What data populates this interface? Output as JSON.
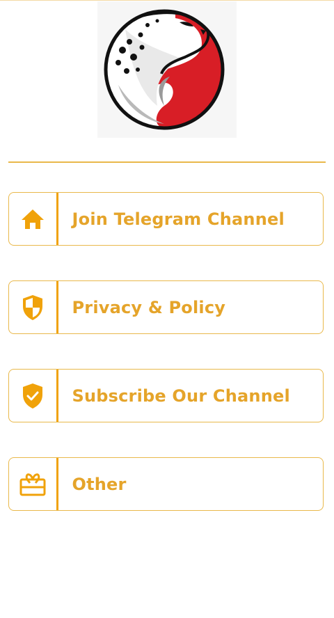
{
  "app": {
    "logo_name": "cheetah-logo"
  },
  "colors": {
    "accent": "#f0a20a",
    "text": "#e5a42a",
    "border": "#e9b84a",
    "logo_red": "#d81e26"
  },
  "menu": {
    "items": [
      {
        "label": "Join Telegram Channel",
        "icon": "home-icon"
      },
      {
        "label": "Privacy & Policy",
        "icon": "shield-icon"
      },
      {
        "label": "Subscribe Our Channel",
        "icon": "shield-check-icon"
      },
      {
        "label": "Other",
        "icon": "gift-icon"
      }
    ]
  }
}
